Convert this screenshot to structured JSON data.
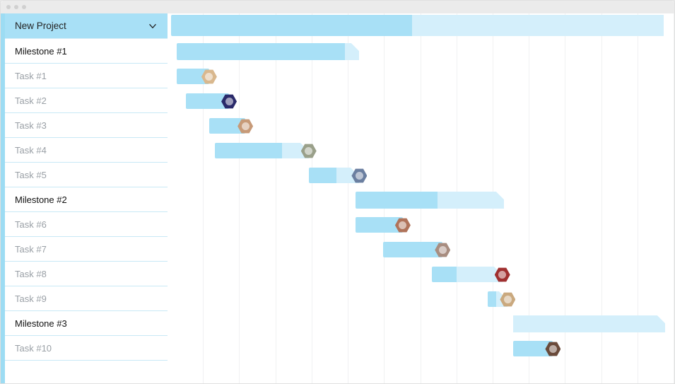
{
  "project": {
    "title": "New Project"
  },
  "sidebar": [
    {
      "kind": "milestone",
      "label": "Milestone #1"
    },
    {
      "kind": "task",
      "label": "Task #1"
    },
    {
      "kind": "task",
      "label": "Task #2"
    },
    {
      "kind": "task",
      "label": "Task #3"
    },
    {
      "kind": "task",
      "label": "Task #4"
    },
    {
      "kind": "task",
      "label": "Task #5"
    },
    {
      "kind": "milestone",
      "label": "Milestone #2"
    },
    {
      "kind": "task",
      "label": "Task #6"
    },
    {
      "kind": "task",
      "label": "Task #7"
    },
    {
      "kind": "task",
      "label": "Task #8"
    },
    {
      "kind": "task",
      "label": "Task #9"
    },
    {
      "kind": "milestone",
      "label": "Milestone #3"
    },
    {
      "kind": "task",
      "label": "Task #10"
    }
  ],
  "colors": {
    "bar": "#a8e0f6",
    "barPale": "#d4effb",
    "sidebarAccent": "#9ddcf3"
  },
  "chart_data": {
    "type": "bar",
    "orientation": "horizontal-gantt",
    "xlabel": "",
    "ylabel": "",
    "xlim": [
      0,
      14
    ],
    "grid": {
      "vertical": true,
      "columns": 14
    },
    "rows": [
      {
        "name": "New Project",
        "kind": "total",
        "start": 0.1,
        "duration": 13.6,
        "progress": 0.49
      },
      {
        "name": "Milestone #1",
        "kind": "milestone",
        "start": 0.25,
        "duration": 5.05,
        "progress": 0.92
      },
      {
        "name": "Task #1",
        "kind": "task",
        "start": 0.25,
        "duration": 0.9,
        "assignee_color": "#d9b88e"
      },
      {
        "name": "Task #2",
        "kind": "task",
        "start": 0.5,
        "duration": 1.2,
        "assignee_color": "#2a2a6a"
      },
      {
        "name": "Task #3",
        "kind": "task",
        "start": 1.15,
        "duration": 1.0,
        "assignee_color": "#c79a78"
      },
      {
        "name": "Task #4",
        "kind": "task",
        "start": 1.3,
        "duration": 2.6,
        "progress": 0.72,
        "assignee_color": "#9aa08a"
      },
      {
        "name": "Task #5",
        "kind": "task",
        "start": 3.9,
        "duration": 1.4,
        "progress": 0.55,
        "assignee_color": "#6b7fa0"
      },
      {
        "name": "Milestone #2",
        "kind": "milestone",
        "start": 5.2,
        "duration": 4.1,
        "progress": 0.55
      },
      {
        "name": "Task #6",
        "kind": "task",
        "start": 5.2,
        "duration": 1.3,
        "assignee_color": "#b0735a"
      },
      {
        "name": "Task #7",
        "kind": "task",
        "start": 5.95,
        "duration": 1.65,
        "assignee_color": "#a88d80"
      },
      {
        "name": "Task #8",
        "kind": "task",
        "start": 7.3,
        "duration": 1.95,
        "progress": 0.35,
        "assignee_color": "#a03030"
      },
      {
        "name": "Task #9",
        "kind": "task",
        "start": 8.85,
        "duration": 0.55,
        "progress": 0.4,
        "assignee_color": "#caa97f"
      },
      {
        "name": "Milestone #3",
        "kind": "milestone",
        "start": 9.55,
        "duration": 4.2,
        "progress": 0.0
      },
      {
        "name": "Task #10",
        "kind": "task",
        "start": 9.55,
        "duration": 1.1,
        "assignee_color": "#6a4a3a"
      }
    ]
  }
}
